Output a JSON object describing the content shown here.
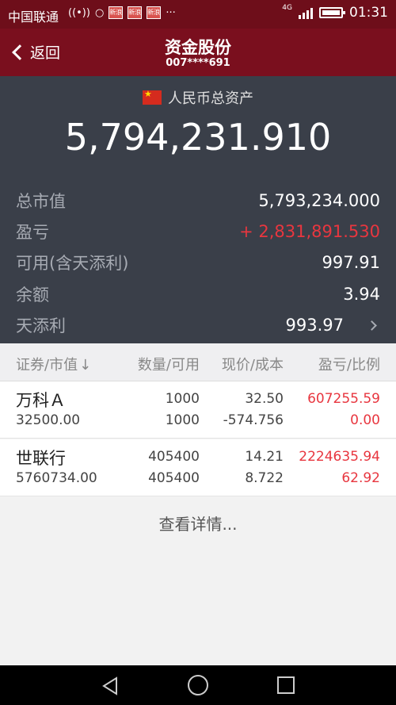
{
  "status_bar": {
    "carrier": "中国联通",
    "app_badge": "新浪",
    "more": "···",
    "network": "4G",
    "time": "01:31"
  },
  "header": {
    "back_label": "返回",
    "title": "资金股份",
    "account": "007****691"
  },
  "summary": {
    "currency_label": "人民币总资产",
    "total_assets": "5,794,231.910",
    "rows": [
      {
        "label": "总市值",
        "value": "5,793,234.000"
      },
      {
        "label": "盈亏",
        "value": "+ 2,831,891.530"
      },
      {
        "label": "可用(含天添利)",
        "value": "997.91"
      },
      {
        "label": "余额",
        "value": "3.94"
      },
      {
        "label": "天添利",
        "value": "993.97"
      }
    ]
  },
  "table": {
    "columns": [
      "证券/市值",
      "数量/可用",
      "现价/成本",
      "盈亏/比例"
    ],
    "sort_indicator": "↓",
    "rows": [
      {
        "name": "万科Ａ",
        "market_value": "32500.00",
        "quantity": "1000",
        "available": "1000",
        "price": "32.50",
        "cost": "-574.756",
        "profit": "607255.59",
        "ratio": "0.00"
      },
      {
        "name": "世联行",
        "market_value": "5760734.00",
        "quantity": "405400",
        "available": "405400",
        "price": "14.21",
        "cost": "8.722",
        "profit": "2224635.94",
        "ratio": "62.92"
      }
    ]
  },
  "more_label": "查看详情...",
  "colors": {
    "header": "#7a0f1e",
    "summary_bg": "#3a3f49",
    "profit_red": "#e8363f"
  }
}
